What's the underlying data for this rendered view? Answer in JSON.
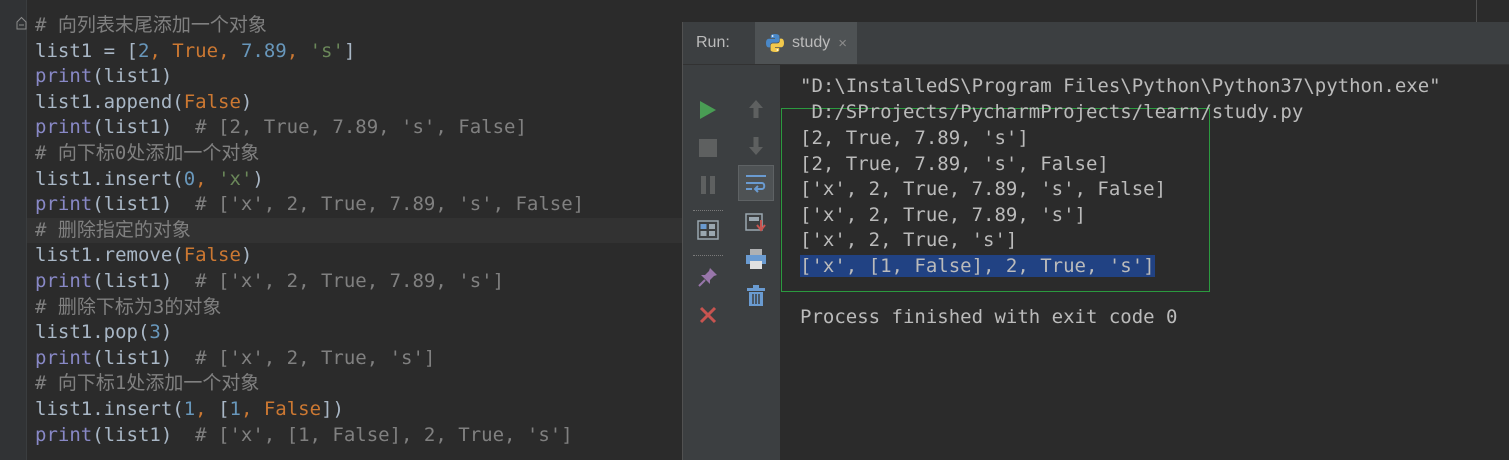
{
  "editor": {
    "lines": [
      {
        "parts": [
          [
            "c",
            "# 向列表末尾添加一个对象"
          ]
        ]
      },
      {
        "parts": [
          [
            "p",
            "list1 = ["
          ],
          [
            "n",
            "2"
          ],
          [
            "k",
            ", "
          ],
          [
            "k",
            "True"
          ],
          [
            "k",
            ", "
          ],
          [
            "n",
            "7.89"
          ],
          [
            "k",
            ", "
          ],
          [
            "s",
            "'s'"
          ],
          [
            "p",
            "]"
          ]
        ]
      },
      {
        "parts": [
          [
            "b",
            "print"
          ],
          [
            "p",
            "(list1)"
          ]
        ]
      },
      {
        "parts": [
          [
            "p",
            "list1.append("
          ],
          [
            "k",
            "False"
          ],
          [
            "p",
            ")"
          ]
        ]
      },
      {
        "parts": [
          [
            "b",
            "print"
          ],
          [
            "p",
            "(list1)  "
          ],
          [
            "c",
            "# [2, True, 7.89, 's', False]"
          ]
        ]
      },
      {
        "parts": [
          [
            "c",
            "# 向下标0处添加一个对象"
          ]
        ]
      },
      {
        "parts": [
          [
            "p",
            "list1.insert("
          ],
          [
            "n",
            "0"
          ],
          [
            "k",
            ", "
          ],
          [
            "s",
            "'x'"
          ],
          [
            "p",
            ")"
          ]
        ]
      },
      {
        "parts": [
          [
            "b",
            "print"
          ],
          [
            "p",
            "(list1)  "
          ],
          [
            "c",
            "# ['x', 2, True, 7.89, 's', False]"
          ]
        ]
      },
      {
        "parts": [
          [
            "c",
            "# 删除指定的对象"
          ]
        ],
        "highlight": true
      },
      {
        "parts": [
          [
            "p",
            "list1.remove("
          ],
          [
            "k",
            "False"
          ],
          [
            "p",
            ")"
          ]
        ]
      },
      {
        "parts": [
          [
            "b",
            "print"
          ],
          [
            "p",
            "(list1)  "
          ],
          [
            "c",
            "# ['x', 2, True, 7.89, 's']"
          ]
        ]
      },
      {
        "parts": [
          [
            "c",
            "# 删除下标为3的对象"
          ]
        ]
      },
      {
        "parts": [
          [
            "p",
            "list1.pop("
          ],
          [
            "n",
            "3"
          ],
          [
            "p",
            ")"
          ]
        ]
      },
      {
        "parts": [
          [
            "b",
            "print"
          ],
          [
            "p",
            "(list1)  "
          ],
          [
            "c",
            "# ['x', 2, True, 's']"
          ]
        ]
      },
      {
        "parts": [
          [
            "c",
            "# 向下标1处添加一个对象"
          ]
        ]
      },
      {
        "parts": [
          [
            "p",
            "list1.insert("
          ],
          [
            "n",
            "1"
          ],
          [
            "k",
            ", "
          ],
          [
            "p",
            "["
          ],
          [
            "n",
            "1"
          ],
          [
            "k",
            ", "
          ],
          [
            "k",
            "False"
          ],
          [
            "p",
            "])"
          ]
        ]
      },
      {
        "parts": [
          [
            "b",
            "print"
          ],
          [
            "p",
            "(list1)  "
          ],
          [
            "c",
            "# ['x', [1, False], 2, True, 's']"
          ]
        ]
      }
    ]
  },
  "run": {
    "label": "Run:",
    "tab": {
      "name": "study",
      "close": "×"
    },
    "toolbar_left": [
      {
        "name": "rerun-icon",
        "color": "#499c54"
      },
      {
        "name": "stop-icon",
        "color": "#5e6060"
      },
      {
        "name": "pause-icon",
        "color": "#5e6060"
      },
      {
        "name": "dump-threads-icon"
      },
      {
        "name": "pin-tab-icon"
      },
      {
        "name": "close-run-icon",
        "color": "#c75450"
      }
    ],
    "toolbar_right": [
      {
        "name": "up-arrow-icon"
      },
      {
        "name": "down-arrow-icon"
      },
      {
        "name": "soft-wrap-icon"
      },
      {
        "name": "scroll-to-end-icon"
      },
      {
        "name": "print-icon"
      },
      {
        "name": "clear-all-icon"
      }
    ],
    "console": {
      "lines": [
        "\"D:\\InstalledS\\Program Files\\Python\\Python37\\python.exe\"",
        " D:/SProjects/PycharmProjects/learn/study.py",
        "[2, True, 7.89, 's']",
        "[2, True, 7.89, 's', False]",
        "['x', 2, True, 7.89, 's', False]",
        "['x', 2, True, 7.89, 's']",
        "['x', 2, True, 's']",
        "['x', [1, False], 2, True, 's']",
        "",
        "Process finished with exit code 0"
      ],
      "selected_index": 7
    }
  }
}
